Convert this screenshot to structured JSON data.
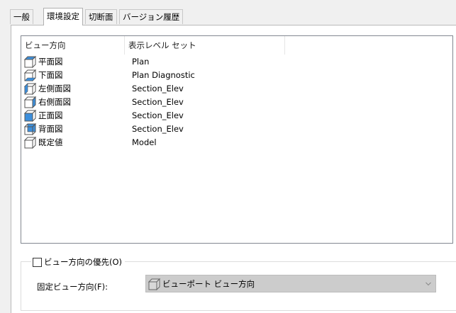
{
  "tabs": [
    {
      "label": "一般",
      "active": false
    },
    {
      "label": "環境設定",
      "active": true
    },
    {
      "label": "切断面",
      "active": false
    },
    {
      "label": "バージョン履歴",
      "active": false
    }
  ],
  "list": {
    "columns": [
      "ビュー方向",
      "表示レベル セット"
    ],
    "rows": [
      {
        "name": "平面図",
        "level": "Plan",
        "icon": "top-view-cube-icon"
      },
      {
        "name": "下面図",
        "level": "Plan Diagnostic",
        "icon": "bottom-view-cube-icon"
      },
      {
        "name": "左側面図",
        "level": "Section_Elev",
        "icon": "left-view-cube-icon"
      },
      {
        "name": "右側面図",
        "level": "Section_Elev",
        "icon": "right-view-cube-icon"
      },
      {
        "name": "正面図",
        "level": "Section_Elev",
        "icon": "front-view-cube-icon"
      },
      {
        "name": "背面図",
        "level": "Section_Elev",
        "icon": "back-view-cube-icon"
      },
      {
        "name": "既定値",
        "level": "Model",
        "icon": "default-view-cube-icon"
      }
    ]
  },
  "override": {
    "checkbox_label": "ビュー方向の優先(O)",
    "checked": false,
    "fixed_label": "固定ビュー方向(F):",
    "combo_value": "ビューポート ビュー方向",
    "combo_icon": "viewport-cube-icon"
  },
  "colors": {
    "cube_highlight": "#3c8fdc",
    "cube_outline": "#555555",
    "combo_disabled": "#cccccc"
  }
}
